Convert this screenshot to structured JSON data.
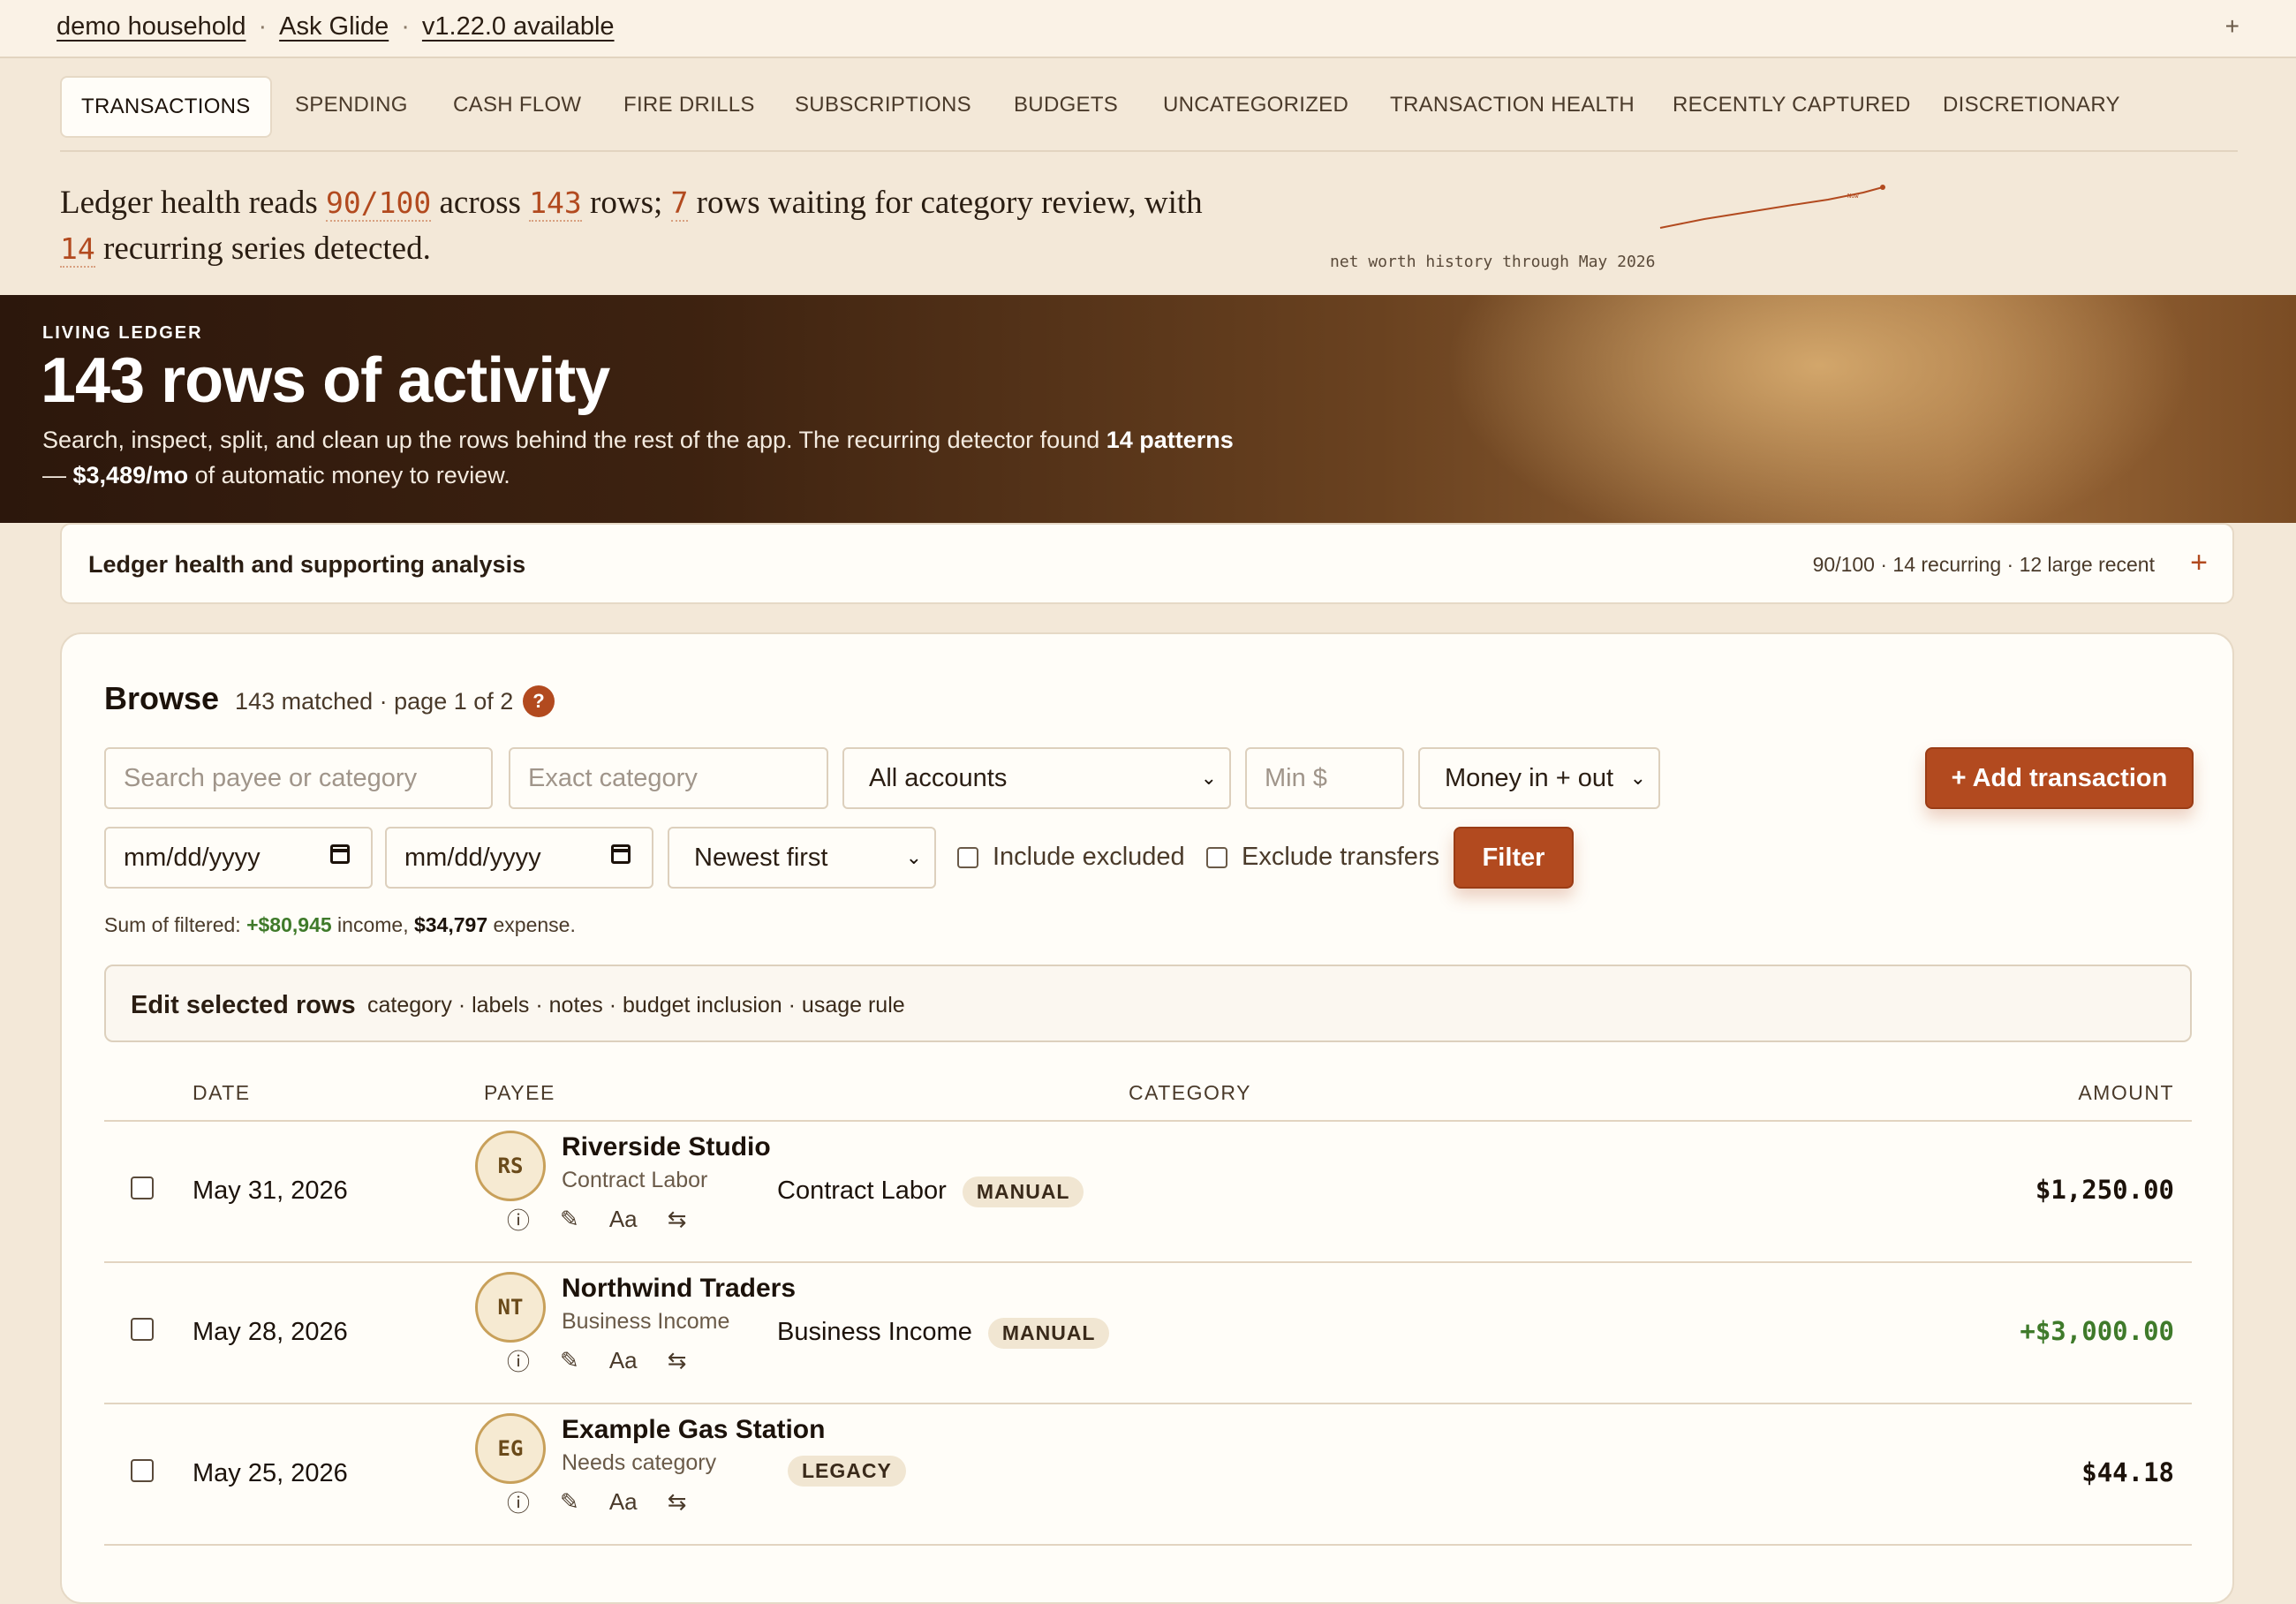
{
  "topbar": {
    "household": "demo household",
    "ask": "Ask Glide",
    "version": "v1.22.0 available",
    "separator": "·",
    "plus": "+"
  },
  "tabs": [
    {
      "label": "TRANSACTIONS",
      "active": true
    },
    {
      "label": "SPENDING"
    },
    {
      "label": "CASH FLOW"
    },
    {
      "label": "FIRE DRILLS"
    },
    {
      "label": "SUBSCRIPTIONS"
    },
    {
      "label": "BUDGETS"
    },
    {
      "label": "UNCATEGORIZED"
    },
    {
      "label": "TRANSACTION HEALTH"
    },
    {
      "label": "RECENTLY CAPTURED"
    },
    {
      "label": "DISCRETIONARY"
    }
  ],
  "summary": {
    "t1": "Ledger health reads ",
    "score": "90/100",
    "t2": " across ",
    "rows": "143",
    "t3": " rows; ",
    "waiting": "7",
    "t4": " rows waiting for category review, with ",
    "recurring": "14",
    "t5": " recurring series detected.",
    "sparkline_caption": "net worth history through May 2026",
    "sparkline_label": "Now"
  },
  "hero": {
    "kicker": "LIVING LEDGER",
    "title": "143 rows of activity",
    "desc_1": "Search, inspect, split, and clean up the rows behind the rest of the app. The recurring detector found ",
    "desc_patterns": "14 patterns",
    "desc_2": " — ",
    "desc_amount": "$3,489/mo",
    "desc_3": " of automatic money to review."
  },
  "collapse": {
    "title": "Ledger health and supporting analysis",
    "meta": "90/100 · 14 recurring · 12 large recent",
    "plus": "+"
  },
  "browse": {
    "title": "Browse",
    "meta": "143 matched · page 1 of 2",
    "help": "?",
    "filters": {
      "search_placeholder": "Search payee or category",
      "category_placeholder": "Exact category",
      "account_value": "All accounts",
      "min_placeholder": "Min $",
      "direction_value": "Money in + out",
      "date_from": "mm/dd/yyyy",
      "date_to": "mm/dd/yyyy",
      "sort_value": "Newest first",
      "include_excluded": "Include excluded",
      "exclude_transfers": "Exclude transfers",
      "filter_button": "Filter",
      "add_button": "+ Add transaction"
    },
    "sum": {
      "prefix": "Sum of filtered: ",
      "income": "+$80,945",
      "income_suffix": " income, ",
      "expense": "$34,797",
      "expense_suffix": " expense."
    },
    "edit_bar": {
      "title": "Edit selected rows",
      "options": "category · labels · notes · budget inclusion · usage rule"
    },
    "columns": {
      "date": "DATE",
      "payee": "PAYEE",
      "category": "CATEGORY",
      "amount": "AMOUNT"
    },
    "rows": [
      {
        "date": "May 31, 2026",
        "initials": "RS",
        "payee": "Riverside Studio",
        "sub": "Contract Labor",
        "category": "Contract Labor",
        "badge": "MANUAL",
        "amount": "$1,250.00",
        "positive": false
      },
      {
        "date": "May 28, 2026",
        "initials": "NT",
        "payee": "Northwind Traders",
        "sub": "Business Income",
        "category": "Business Income",
        "badge": "MANUAL",
        "amount": "+$3,000.00",
        "positive": true
      },
      {
        "date": "May 25, 2026",
        "initials": "EG",
        "payee": "Example Gas Station",
        "sub": "Needs category",
        "category": "",
        "badge": "LEGACY",
        "amount": "$44.18",
        "positive": false
      }
    ],
    "row_actions": {
      "info": "ⓘ",
      "edit": "✎",
      "text": "Aa",
      "transfer": "⇆"
    }
  },
  "colors": {
    "accent": "#b24a1f",
    "income": "#3f7a2a",
    "bg": "#f3e8d8",
    "card": "#fffdf8"
  }
}
